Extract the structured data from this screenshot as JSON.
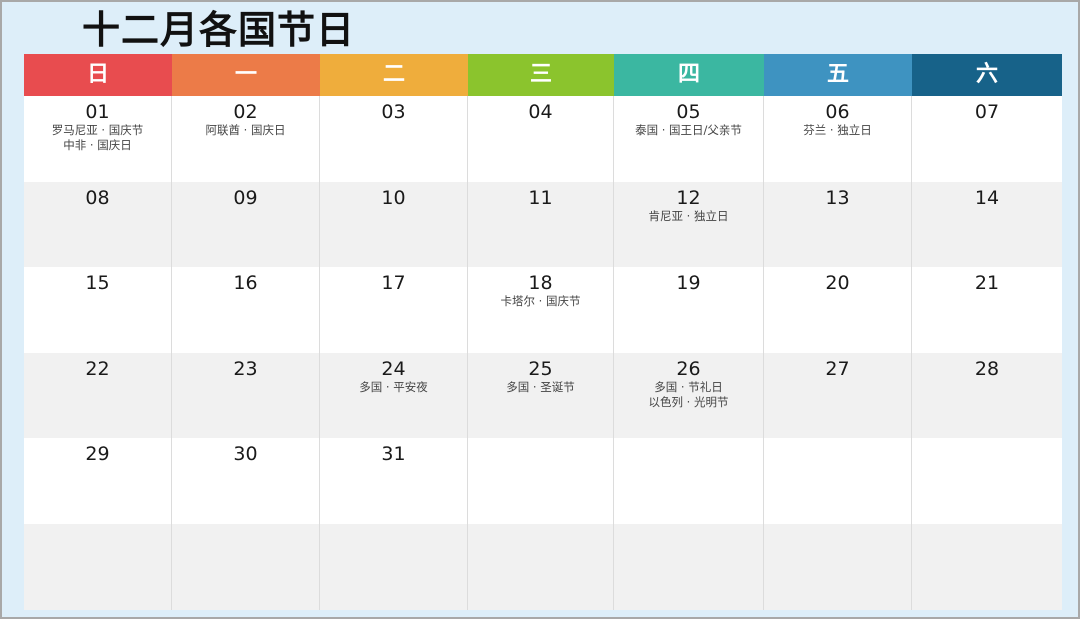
{
  "title": "十二月各国节日",
  "weekdays": [
    {
      "label": "日",
      "color": "#e84c4f"
    },
    {
      "label": "一",
      "color": "#ec7b48"
    },
    {
      "label": "二",
      "color": "#efad3c"
    },
    {
      "label": "三",
      "color": "#8bc42d"
    },
    {
      "label": "四",
      "color": "#3bb7a1"
    },
    {
      "label": "五",
      "color": "#3e93c1"
    },
    {
      "label": "六",
      "color": "#176289"
    }
  ],
  "weeks": [
    [
      {
        "day": "01",
        "holidays": [
          "罗马尼亚 · 国庆节",
          "中非 · 国庆日"
        ]
      },
      {
        "day": "02",
        "holidays": [
          "阿联酋 · 国庆日"
        ]
      },
      {
        "day": "03",
        "holidays": []
      },
      {
        "day": "04",
        "holidays": []
      },
      {
        "day": "05",
        "holidays": [
          "泰国 · 国王日/父亲节"
        ]
      },
      {
        "day": "06",
        "holidays": [
          "芬兰 · 独立日"
        ]
      },
      {
        "day": "07",
        "holidays": []
      }
    ],
    [
      {
        "day": "08",
        "holidays": []
      },
      {
        "day": "09",
        "holidays": []
      },
      {
        "day": "10",
        "holidays": []
      },
      {
        "day": "11",
        "holidays": []
      },
      {
        "day": "12",
        "holidays": [
          "肯尼亚 · 独立日"
        ]
      },
      {
        "day": "13",
        "holidays": []
      },
      {
        "day": "14",
        "holidays": []
      }
    ],
    [
      {
        "day": "15",
        "holidays": []
      },
      {
        "day": "16",
        "holidays": []
      },
      {
        "day": "17",
        "holidays": []
      },
      {
        "day": "18",
        "holidays": [
          "卡塔尔 · 国庆节"
        ]
      },
      {
        "day": "19",
        "holidays": []
      },
      {
        "day": "20",
        "holidays": []
      },
      {
        "day": "21",
        "holidays": []
      }
    ],
    [
      {
        "day": "22",
        "holidays": []
      },
      {
        "day": "23",
        "holidays": []
      },
      {
        "day": "24",
        "holidays": [
          "多国 · 平安夜"
        ]
      },
      {
        "day": "25",
        "holidays": [
          "多国 · 圣诞节"
        ]
      },
      {
        "day": "26",
        "holidays": [
          "多国 · 节礼日",
          "以色列 · 光明节"
        ]
      },
      {
        "day": "27",
        "holidays": []
      },
      {
        "day": "28",
        "holidays": []
      }
    ],
    [
      {
        "day": "29",
        "holidays": []
      },
      {
        "day": "30",
        "holidays": []
      },
      {
        "day": "31",
        "holidays": []
      },
      {
        "day": "",
        "holidays": []
      },
      {
        "day": "",
        "holidays": []
      },
      {
        "day": "",
        "holidays": []
      },
      {
        "day": "",
        "holidays": []
      }
    ],
    [
      {
        "day": "",
        "holidays": []
      },
      {
        "day": "",
        "holidays": []
      },
      {
        "day": "",
        "holidays": []
      },
      {
        "day": "",
        "holidays": []
      },
      {
        "day": "",
        "holidays": []
      },
      {
        "day": "",
        "holidays": []
      },
      {
        "day": "",
        "holidays": []
      }
    ]
  ]
}
